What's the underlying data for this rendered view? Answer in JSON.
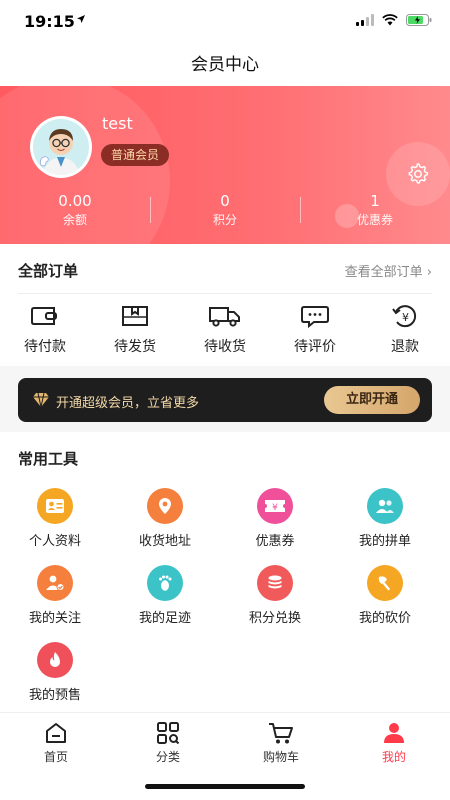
{
  "status": {
    "time": "19:15",
    "location_icon": "location-arrow-icon",
    "signal_level": 2,
    "battery_charging": true
  },
  "nav": {
    "title": "会员中心"
  },
  "profile": {
    "username": "test",
    "member_level": "普通会员",
    "stats": [
      {
        "value": "0.00",
        "label": "余额"
      },
      {
        "value": "0",
        "label": "积分"
      },
      {
        "value": "1",
        "label": "优惠券"
      }
    ],
    "settings_icon": "gear-icon"
  },
  "orders": {
    "title": "全部订单",
    "view_all": "查看全部订单 ›",
    "items": [
      {
        "label": "待付款",
        "icon": "wallet-icon"
      },
      {
        "label": "待发货",
        "icon": "package-icon"
      },
      {
        "label": "待收货",
        "icon": "truck-icon"
      },
      {
        "label": "待评价",
        "icon": "comment-icon"
      },
      {
        "label": "退款",
        "icon": "refund-icon"
      }
    ]
  },
  "vip": {
    "text": "开通超级会员，立省更多",
    "button": "立即开通"
  },
  "tools": {
    "title": "常用工具",
    "items": [
      {
        "label": "个人资料",
        "icon": "profile-card-icon",
        "color": "#f5a623"
      },
      {
        "label": "收货地址",
        "icon": "location-pin-icon",
        "color": "#f5803e"
      },
      {
        "label": "优惠券",
        "icon": "coupon-icon",
        "color": "#f0509a"
      },
      {
        "label": "我的拼单",
        "icon": "group-icon",
        "color": "#3cc3c8"
      },
      {
        "label": "我的关注",
        "icon": "follow-icon",
        "color": "#f5803e"
      },
      {
        "label": "我的足迹",
        "icon": "footprint-icon",
        "color": "#3cc3c8"
      },
      {
        "label": "积分兑换",
        "icon": "points-coins-icon",
        "color": "#f05a5a"
      },
      {
        "label": "我的砍价",
        "icon": "axe-icon",
        "color": "#f5a623"
      },
      {
        "label": "我的预售",
        "icon": "flame-icon",
        "color": "#f0505a"
      }
    ]
  },
  "tabbar": {
    "active": "我的",
    "items": [
      {
        "label": "首页",
        "icon": "home-icon"
      },
      {
        "label": "分类",
        "icon": "category-icon"
      },
      {
        "label": "购物车",
        "icon": "cart-icon"
      },
      {
        "label": "我的",
        "icon": "user-icon"
      }
    ]
  },
  "colors": {
    "accent": "#ff3b4a",
    "header_start": "#ff5a5f",
    "header_end": "#ff8a8d",
    "vip_bg": "#1e1e1e",
    "vip_gold": "#d4a66a"
  }
}
